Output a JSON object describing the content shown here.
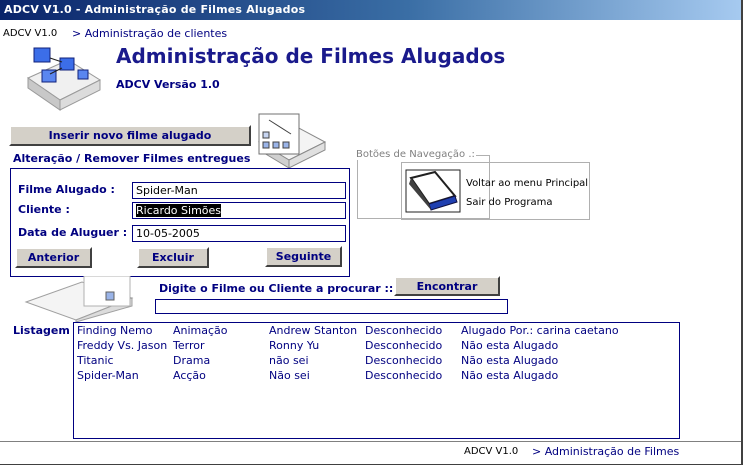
{
  "window": {
    "title": "ADCV V1.0 - Administração de Filmes Alugados"
  },
  "header": {
    "version_tag": "ADCV V1.0",
    "nav_link": "> Administração de clientes",
    "title": "Administração de Filmes Alugados",
    "subtitle": "ADCV Versão 1.0"
  },
  "actions": {
    "insert_button": "Inserir novo filme alugado"
  },
  "edit_group": {
    "title": "Alteração / Remover Filmes entregues",
    "movie_label": "Filme Alugado :",
    "movie_value": "Spider-Man",
    "client_label": "Cliente :",
    "client_value": "Ricardo Simões",
    "date_label": "Data de Aluguer :",
    "date_value": "10-05-2005",
    "prev_button": "Anterior",
    "delete_button": "Excluir",
    "next_button": "Seguinte"
  },
  "nav_group": {
    "title": "Botões de Navegação .:",
    "back_link": "Voltar ao menu Principal",
    "exit_link": "Sair do Programa"
  },
  "search": {
    "prompt": "Digite o Filme ou Cliente a procurar ::",
    "button": "Encontrar",
    "value": ""
  },
  "listing": {
    "label": "Listagem",
    "rows": [
      [
        "Finding Nemo",
        "Animação",
        "Andrew Stanton",
        "Desconhecido",
        "Alugado Por.: carina caetano"
      ],
      [
        "Freddy Vs. Jason",
        "Terror",
        "Ronny Yu",
        "Desconhecido",
        "Não esta Alugado"
      ],
      [
        "Titanic",
        "Drama",
        "não sei",
        "Desconhecido",
        "Não esta Alugado"
      ],
      [
        "Spider-Man",
        "Acção",
        "Não sei",
        "Desconhecido",
        "Não esta Alugado"
      ]
    ]
  },
  "footer": {
    "version_tag": "ADCV V1.0",
    "nav_link": "> Administração de Filmes"
  },
  "icons": {
    "logo": "cubes-logo-icon",
    "films": "film-folder-icon",
    "search": "search-folder-icon",
    "monitor": "monitor-icon"
  },
  "colors": {
    "accent": "#000080",
    "title_bar": "#0a246a",
    "button_face": "#d4d0c8"
  }
}
